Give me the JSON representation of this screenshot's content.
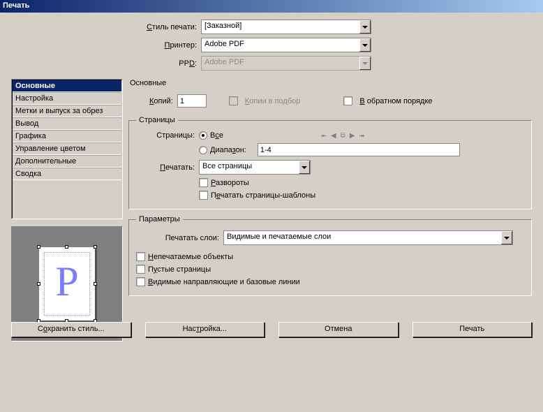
{
  "window_title": "Печать",
  "labels": {
    "style": "Стиль печати:",
    "printer": "Принтер:",
    "ppd": "PPD:",
    "section_title": "Основные",
    "copies": "Копий:",
    "collate": "Копии в подбор",
    "reverse": "В обратном порядке",
    "pages_group": "Страницы",
    "pages_label": "Страницы:",
    "all": "Все",
    "range": "Диапазон:",
    "print_what": "Печатать:",
    "spread": "Развороты",
    "master": "Печатать страницы-шаблоны",
    "params_group": "Параметры",
    "print_layers": "Печатать слои:",
    "nonprint": "Непечатаемые объекты",
    "blank": "Пустые страницы",
    "guides": "Видимые направляющие и базовые линии"
  },
  "values": {
    "style": "[Заказной]",
    "printer": "Adobe PDF",
    "ppd": "Adobe PDF",
    "copies": "1",
    "range": "1-4",
    "pages_select": "Все страницы",
    "layers_select": "Видимые и печатаемые слои"
  },
  "sidebar": {
    "items": [
      "Основные",
      "Настройка",
      "Метки и выпуск за обрез",
      "Вывод",
      "Графика",
      "Управление цветом",
      "Дополнительные",
      "Сводка"
    ],
    "selected_index": 0
  },
  "buttons": {
    "save_style": "Сохранить стиль...",
    "setup": "Настройка...",
    "cancel": "Отмена",
    "print": "Печать"
  },
  "preview_letter": "P"
}
